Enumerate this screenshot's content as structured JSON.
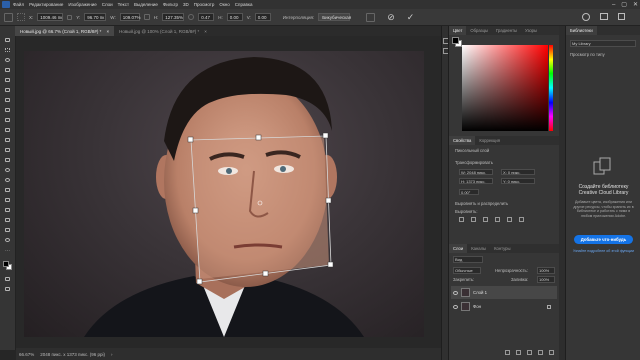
{
  "menu": {
    "items": [
      "Файл",
      "Редактирование",
      "Изображение",
      "Слои",
      "Текст",
      "Выделение",
      "Фильтр",
      "3D",
      "Просмотр",
      "Окно",
      "Справка"
    ],
    "window_controls": [
      "–",
      "▢",
      "✕"
    ]
  },
  "options": {
    "ref_x": "1009.46 пк",
    "ref_y": "96.70 пк",
    "width": "109.07%",
    "height": "127.35%",
    "angle": "0.47",
    "h_skew": "0.00",
    "v_skew": "0.00",
    "interp_label": "Интерполяция:",
    "interp_value": "Бикубическая",
    "cancel_glyph": "⊘",
    "commit_glyph": "✓"
  },
  "doc_tabs": [
    {
      "label": "Новый.jpg @ 66.7% (Слой 1, RGB/8#) *",
      "close": "×"
    },
    {
      "label": "Новый.jpg @ 100% (Слой 1, RGB/8#) *",
      "close": "×"
    }
  ],
  "status": {
    "zoom": "66.67%",
    "doc_info": "2048 пикс. x 1373 пикс. (96 ppi)"
  },
  "color_panel": {
    "tabs": [
      "Цвет",
      "Образцы",
      "Градиенты",
      "Узоры"
    ],
    "foreground": "#000000",
    "background": "#ffffff"
  },
  "properties_panel": {
    "tabs": [
      "Свойства",
      "Коррекция"
    ],
    "layer_type": "Пиксельный слой",
    "transform_header": "Трансформировать",
    "w": "W: 2048 пикс.",
    "h": "H: 1373 пикс.",
    "x": "X: 0 пикс.",
    "y": "Y: 0 пикс.",
    "angle": "0.00°",
    "align_header": "Выровнять и распределить",
    "align_label": "Выровнять:"
  },
  "layers_panel": {
    "tabs": [
      "Слои",
      "Каналы",
      "Контуры"
    ],
    "blend_mode": "Обычные",
    "opacity_label": "Непрозрачность:",
    "opacity": "100%",
    "lock_label": "Закрепить:",
    "fill_label": "Заливка:",
    "fill": "100%",
    "layers": [
      {
        "name": "Слой 1",
        "selected": true
      },
      {
        "name": "Фон",
        "selected": false
      }
    ]
  },
  "library_panel": {
    "tab": "Библиотеки",
    "library_select": "My Library",
    "view_label": "Просмотр по типу",
    "heading": "Создайте библиотеку Creative Cloud Library",
    "body": "Добавьте цвета, изображения или другие ресурсы, чтобы хранить их в библиотеке и работать с ними в любом приложении Adobe.",
    "button": "Добавьте что-нибудь",
    "link": "Узнайте подробнее об этой функции"
  },
  "colors": {
    "accent": "#1473e6",
    "panel": "#363636",
    "canvas_bg": "#282828"
  }
}
